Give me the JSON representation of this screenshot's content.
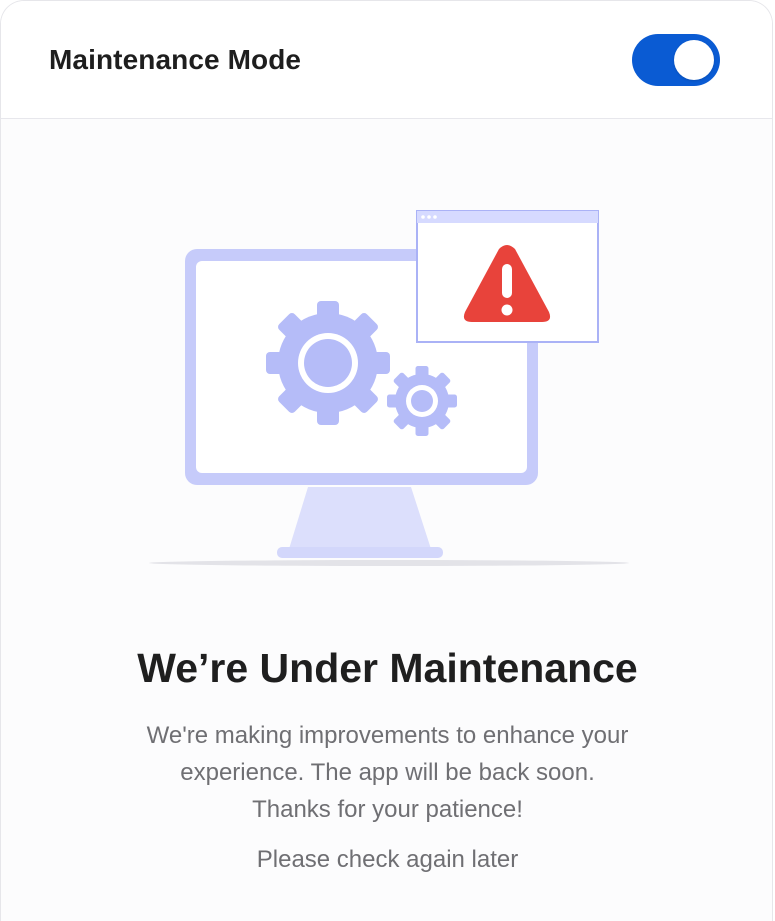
{
  "header": {
    "title": "Maintenance Mode",
    "toggle_state": "on",
    "toggle_color": "#0a5bd3"
  },
  "illustration": {
    "icon": "monitor-gears-warning-icon",
    "accent_color": "#b5bcf8",
    "warning_color": "#e8433b"
  },
  "main": {
    "headline": "We’re Under Maintenance",
    "message_lines": [
      "We're making improvements to enhance your",
      "experience. The app will be back soon.",
      "Thanks for your patience!"
    ],
    "hint": "Please check again later"
  }
}
